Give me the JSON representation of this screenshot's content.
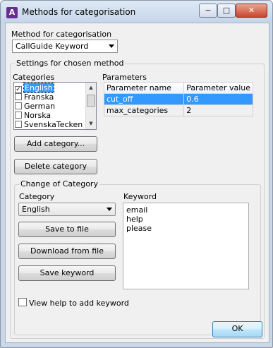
{
  "window": {
    "title": "Methods for categorisation",
    "icon": "A",
    "minimize": "−",
    "maximize": "□",
    "close": "✕"
  },
  "method": {
    "label": "Method for categorisation",
    "selected": "CallGuide Keyword"
  },
  "settings": {
    "group_title": "Settings for chosen method",
    "categories_label": "Categories",
    "categories": [
      {
        "name": "English",
        "checked": true,
        "selected": true
      },
      {
        "name": "Franska",
        "checked": false,
        "selected": false
      },
      {
        "name": "German",
        "checked": false,
        "selected": false
      },
      {
        "name": "Norska",
        "checked": false,
        "selected": false
      },
      {
        "name": "SvenskaTecken",
        "checked": false,
        "selected": false
      }
    ],
    "add_category": "Add category...",
    "delete_category": "Delete category",
    "parameters_label": "Parameters",
    "param_headers": [
      "Parameter name",
      "Parameter value"
    ],
    "params": [
      {
        "name": "cut_off",
        "value": "0.6"
      },
      {
        "name": "max_categories",
        "value": "2"
      }
    ]
  },
  "change": {
    "group_title": "Change of Category",
    "category_label": "Category",
    "category_selected": "English",
    "save_to_file": "Save to file",
    "download_from_file": "Download from file",
    "save_keyword": "Save keyword",
    "keyword_label": "Keyword",
    "keywords": [
      "email",
      "help",
      "please"
    ],
    "view_help": "View help to add keyword"
  },
  "ok": "OK",
  "colors": {
    "selection": "#3399ff",
    "titlebar": "#c4d4e8"
  }
}
